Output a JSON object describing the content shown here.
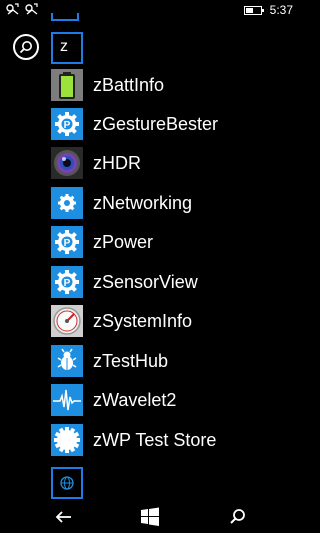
{
  "status": {
    "time": "5:37",
    "battery_level": 0.55,
    "icons": [
      "notification-icon-1",
      "notification-icon-2"
    ]
  },
  "letter_header": "z",
  "apps": [
    {
      "label": "zBattInfo",
      "icon": "battery-icon"
    },
    {
      "label": "zGestureBester",
      "icon": "gear-p-icon"
    },
    {
      "label": "zHDR",
      "icon": "camera-lens-icon"
    },
    {
      "label": "zNetworking",
      "icon": "gear-icon"
    },
    {
      "label": "zPower",
      "icon": "gear-p-icon"
    },
    {
      "label": "zSensorView",
      "icon": "gear-p-icon"
    },
    {
      "label": "zSystemInfo",
      "icon": "gauge-icon"
    },
    {
      "label": "zTestHub",
      "icon": "bug-icon"
    },
    {
      "label": "zWavelet2",
      "icon": "waveform-icon"
    },
    {
      "label": "zWP Test Store",
      "icon": "badge-icon"
    }
  ],
  "bottom_tile_icon": "globe-icon",
  "nav": {
    "back": "back-arrow-icon",
    "start": "windows-logo-icon",
    "search": "search-icon"
  },
  "colors": {
    "accent": "#1e8fe0",
    "background": "#000000"
  }
}
